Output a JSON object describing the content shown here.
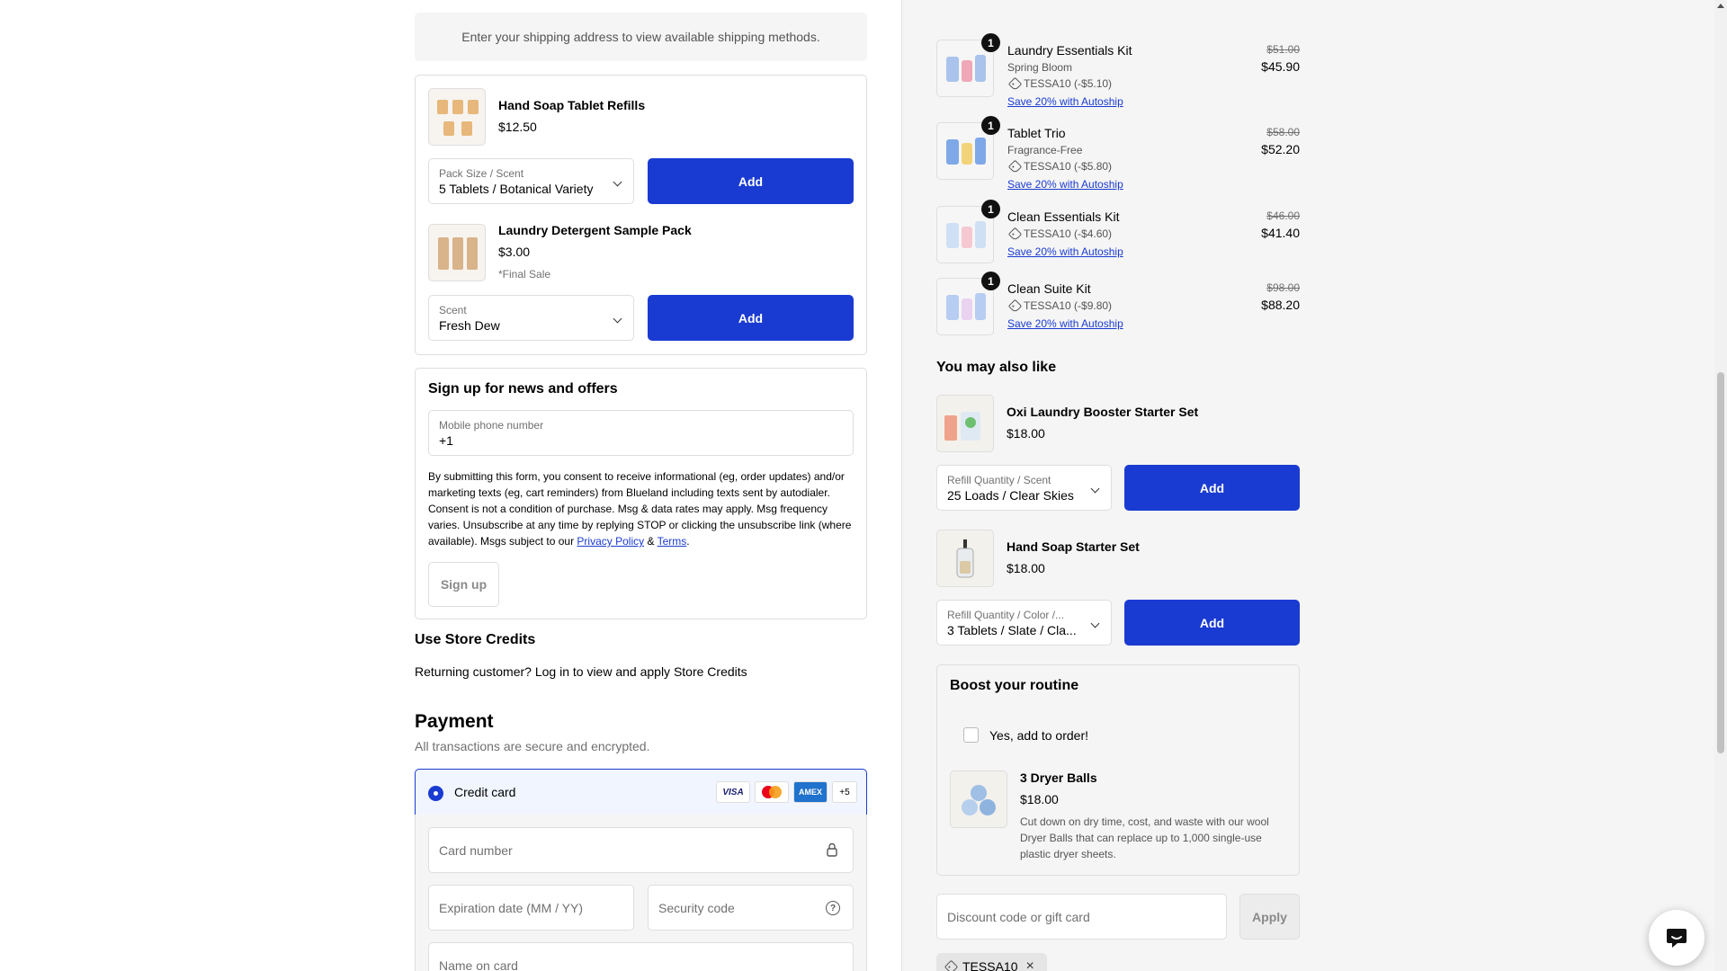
{
  "shipping_notice": "Enter your shipping address to view available shipping methods.",
  "upsells": [
    {
      "name": "Hand Soap Tablet Refills",
      "price": "$12.50",
      "note": "",
      "select_label": "Pack Size / Scent",
      "select_value": "5 Tablets / Botanical Variety",
      "button": "Add"
    },
    {
      "name": "Laundry Detergent Sample Pack",
      "price": "$3.00",
      "note": "*Final Sale",
      "select_label": "Scent",
      "select_value": "Fresh Dew",
      "button": "Add"
    }
  ],
  "signup": {
    "title": "Sign up for news and offers",
    "phone_label": "Mobile phone number",
    "phone_value": "+1",
    "consent_text": "By submitting this form, you consent to receive informational (eg, order updates) and/or marketing texts (eg, cart reminders) from Blueland including texts sent by autodialer. Consent is not a condition of purchase. Msg & data rates may apply. Msg frequency varies. Unsubscribe at any time by replying STOP or clicking the unsubscribe link (where available). Msgs subject to our",
    "privacy_link": "Privacy Policy",
    "amp": "&",
    "terms_link": "Terms",
    "period": ".",
    "button": "Sign up"
  },
  "store_credits": {
    "title": "Use Store Credits",
    "text": "Returning customer? Log in to view and apply Store Credits"
  },
  "payment": {
    "title": "Payment",
    "subtitle": "All transactions are secure and encrypted.",
    "method": "Credit card",
    "cards": [
      "VISA",
      "MC",
      "AMEX"
    ],
    "more_cards": "+5",
    "card_number_placeholder": "Card number",
    "expiration_placeholder": "Expiration date (MM / YY)",
    "security_placeholder": "Security code",
    "name_placeholder": "Name on card"
  },
  "cart": [
    {
      "qty": "1",
      "name": "Laundry Essentials Kit",
      "variant": "Spring Bloom",
      "code": "TESSA10 (-$5.10)",
      "autoship": "Save 20% with Autoship",
      "old_price": "$51.00",
      "new_price": "$45.90"
    },
    {
      "qty": "1",
      "name": "Tablet Trio",
      "variant": "Fragrance-Free",
      "code": "TESSA10 (-$5.80)",
      "autoship": "Save 20% with Autoship",
      "old_price": "$58.00",
      "new_price": "$52.20"
    },
    {
      "qty": "1",
      "name": "Clean Essentials Kit",
      "variant": "",
      "code": "TESSA10 (-$4.60)",
      "autoship": "Save 20% with Autoship",
      "old_price": "$46.00",
      "new_price": "$41.40"
    },
    {
      "qty": "1",
      "name": "Clean Suite Kit",
      "variant": "",
      "code": "TESSA10 (-$9.80)",
      "autoship": "Save 20% with Autoship",
      "old_price": "$98.00",
      "new_price": "$88.20"
    }
  ],
  "also_like": {
    "title": "You may also like",
    "items": [
      {
        "name": "Oxi Laundry Booster Starter Set",
        "price": "$18.00",
        "select_label": "Refill Quantity / Scent",
        "select_value": "25 Loads / Clear Skies",
        "button": "Add"
      },
      {
        "name": "Hand Soap Starter Set",
        "price": "$18.00",
        "select_label": "Refill Quantity / Color /...",
        "select_value": "3 Tablets / Slate / Cla...",
        "button": "Add"
      }
    ]
  },
  "boost": {
    "title": "Boost your routine",
    "checkbox_label": "Yes, add to order!",
    "product_name": "3 Dryer Balls",
    "product_price": "$18.00",
    "description": "Cut down on dry time, cost, and waste with our wool Dryer Balls that can replace up to 1,000 single-use plastic dryer sheets."
  },
  "discount": {
    "placeholder": "Discount code or gift card",
    "button": "Apply",
    "applied_code": "TESSA10"
  },
  "colors": {
    "accent": "#1a3bd1",
    "panel_bg": "#f5f5f5",
    "border": "#dedede"
  }
}
